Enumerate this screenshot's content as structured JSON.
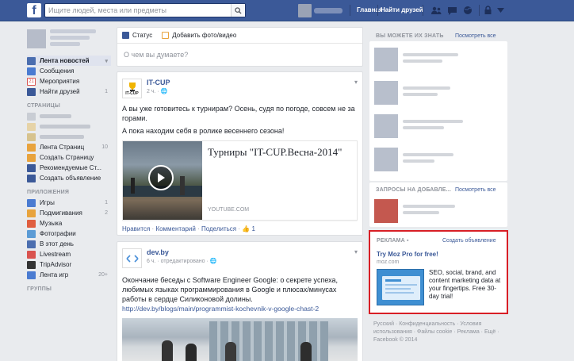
{
  "topbar": {
    "search_placeholder": "Ищите людей, места или предметы",
    "nav_home": "Главная",
    "nav_find_friends": "Найти друзей"
  },
  "sidebar": {
    "items": [
      {
        "label": "Лента новостей",
        "count": "",
        "color": "#4b6eaf"
      },
      {
        "label": "Сообщения",
        "count": "",
        "color": "#4a7bd1"
      },
      {
        "label": "Мероприятия",
        "count": "",
        "color": "#d9534f"
      },
      {
        "label": "Найти друзей",
        "count": "1",
        "color": "#3b5998"
      }
    ],
    "pages_head": "СТРАНИЦЫ",
    "pages_items": [
      {
        "label": "Лента Страниц",
        "count": "10",
        "color": "#e8a33d"
      },
      {
        "label": "Создать Страницу",
        "count": "",
        "color": "#e8a33d"
      },
      {
        "label": "Рекомендуемые Ст...",
        "count": "",
        "color": "#3b5998"
      },
      {
        "label": "Создать объявление",
        "count": "",
        "color": "#3b5998"
      }
    ],
    "apps_head": "ПРИЛОЖЕНИЯ",
    "apps_items": [
      {
        "label": "Игры",
        "count": "1",
        "color": "#4a7bd1"
      },
      {
        "label": "Подмигивания",
        "count": "2",
        "color": "#e8a33d"
      },
      {
        "label": "Музыка",
        "count": "",
        "color": "#e05e3f"
      },
      {
        "label": "Фотографии",
        "count": "",
        "color": "#5b9bd5"
      },
      {
        "label": "В этот день",
        "count": "",
        "color": "#4b6eaf"
      },
      {
        "label": "Livestream",
        "count": "",
        "color": "#d9534f"
      },
      {
        "label": "TripAdvisor",
        "count": "",
        "color": "#333333"
      },
      {
        "label": "Лента игр",
        "count": "20+",
        "color": "#4a7bd1"
      }
    ],
    "groups_head": "ГРУППЫ"
  },
  "composer": {
    "status_tab": "Статус",
    "photo_tab": "Добавить фото/видео",
    "placeholder": "О чем вы думаете?"
  },
  "post1": {
    "author": "IT-CUP",
    "time": "2 ч. ·",
    "text1": "А вы уже готовитесь к турнирам? Осень, судя по погоде, совсем не за горами.",
    "text2": "А пока находим себя в ролике весеннего сезона!",
    "link_title": "Турниры \"IT-CUP.Весна-2014\"",
    "link_domain": "YOUTUBE.COM",
    "like": "Нравится",
    "comment": "Комментарий",
    "share": "Поделиться",
    "likes_count": "1"
  },
  "post2": {
    "author": "dev.by",
    "time": "6 ч. · отредактировано ·",
    "text": "Окончание беседы с Software Engineer Google: о секрете успеха, любимых языках программирования в Google и плюсах/минусах работы в сердце Силиконовой долины.",
    "url": "http://dev.by/blogs/main/programmist-kochevnik-v-google-chast-2"
  },
  "right": {
    "pymk_head": "ВЫ МОЖЕТЕ ИХ ЗНАТЬ",
    "pymk_link": "Посмотреть все",
    "requests_head": "ЗАПРОСЫ НА ДОБАВЛЕ...",
    "requests_link": "Посмотреть все",
    "ad_head": "РЕКЛАМА",
    "ad_create": "Создать объявление",
    "ad_title": "Try Moz Pro for free!",
    "ad_domain": "moz.com",
    "ad_text": "SEO, social, brand, and content marketing data at your fingertips. Free 30-day trial!"
  },
  "footer": {
    "line1": "Русский · Конфиденциальность · Условия использования · Файлы cookie · Реклама · Ещё ·",
    "copyright": "Facebook © 2014"
  },
  "colors": {
    "brand": "#3b5998",
    "highlight": "#d81f26"
  }
}
